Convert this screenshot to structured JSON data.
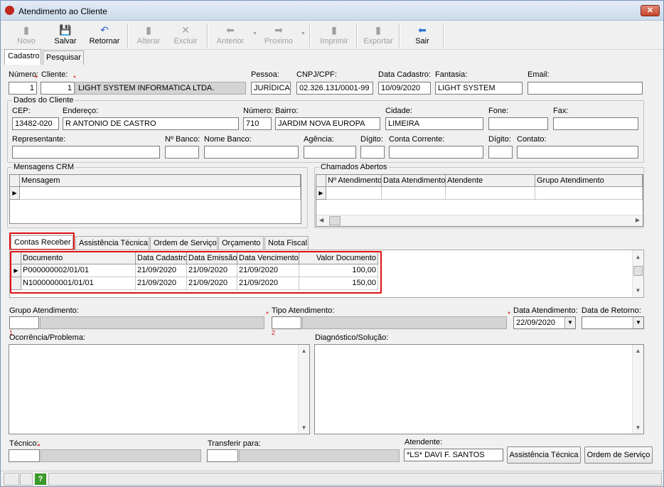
{
  "window": {
    "title": "Atendimento ao Cliente",
    "close": "✕"
  },
  "toolbar": {
    "novo": "Novo",
    "salvar": "Salvar",
    "retornar": "Retornar",
    "alterar": "Alterar",
    "excluir": "Excluir",
    "anterior": "Anterior",
    "proximo": "Proximo",
    "imprimir": "Imprimir",
    "exportar": "Exportar",
    "sair": "Sair"
  },
  "main_tabs": [
    "Cadastro",
    "Pesquisar"
  ],
  "header": {
    "numero_label": "Número:",
    "numero": "1",
    "cliente_label": "Cliente:",
    "cliente_code": "1",
    "cliente_name": "LIGHT SYSTEM INFORMATICA LTDA.",
    "pessoa_label": "Pessoa:",
    "pessoa": "JURÍDICA",
    "cnpj_label": "CNPJ/CPF:",
    "cnpj": "02.326.131/0001-99",
    "data_cadastro_label": "Data Cadastro:",
    "data_cadastro": "10/09/2020",
    "fantasia_label": "Fantasia:",
    "fantasia": "LIGHT SYSTEM",
    "email_label": "Email:",
    "email": ""
  },
  "dados_cliente": {
    "title": "Dados do Cliente",
    "cep_label": "CEP:",
    "cep": "13482-020",
    "endereco_label": "Endereço:",
    "endereco": "R ANTONIO DE CASTRO",
    "numero_label": "Número:",
    "numero": "710",
    "bairro_label": "Bairro:",
    "bairro": "JARDIM NOVA EUROPA",
    "cidade_label": "Cidade:",
    "cidade": "LIMEIRA",
    "fone_label": "Fone:",
    "fax_label": "Fax:",
    "representante_label": "Representante:",
    "nbanco_label": "Nº Banco:",
    "nome_banco_label": "Nome Banco:",
    "agencia_label": "Agência:",
    "digito_label": "Dígito:",
    "conta_label": "Conta Corrente:",
    "digito2_label": "Dígito:",
    "contato_label": "Contato:"
  },
  "mensagens": {
    "title": "Mensagens CRM",
    "col": "Mensagem"
  },
  "chamados": {
    "title": "Chamados Abertos",
    "cols": [
      "Nº Atendimento",
      "Data Atendimento",
      "Atendente",
      "Grupo Atendimento"
    ]
  },
  "sub_tabs": [
    "Contas Receber",
    "Assistência Técnica",
    "Ordem de Serviço",
    "Orçamento",
    "Nota Fiscal"
  ],
  "contas": {
    "cols": [
      "Documento",
      "Data Cadastro",
      "Data Emissão",
      "Data Vencimento",
      "Valor Documento"
    ],
    "rows": [
      [
        "P000000002/01/01",
        "21/09/2020",
        "21/09/2020",
        "21/09/2020",
        "100,00"
      ],
      [
        "N1000000001/01/01",
        "21/09/2020",
        "21/09/2020",
        "21/09/2020",
        "150,00"
      ]
    ]
  },
  "atendimento": {
    "grupo_label": "Grupo Atendimento:",
    "tipo_label": "Tipo Atendimento:",
    "data_label": "Data Atendimento:",
    "data": "22/09/2020",
    "retorno_label": "Data de Retorno:",
    "ocorrencia_label": "Ocorrência/Problema:",
    "diagnostico_label": "Diagnóstico/Solução:",
    "tecnico_label": "Técnico:",
    "transferir_label": "Transferir para:",
    "atendente_label": "Atendente:",
    "atendente": "*LS* DAVI F. SANTOS",
    "num1": "1",
    "num2": "2"
  },
  "buttons": {
    "assistencia": "Assistência Técnica",
    "ordem": "Ordem de Serviço"
  },
  "statusbar": {
    "help": "?"
  }
}
